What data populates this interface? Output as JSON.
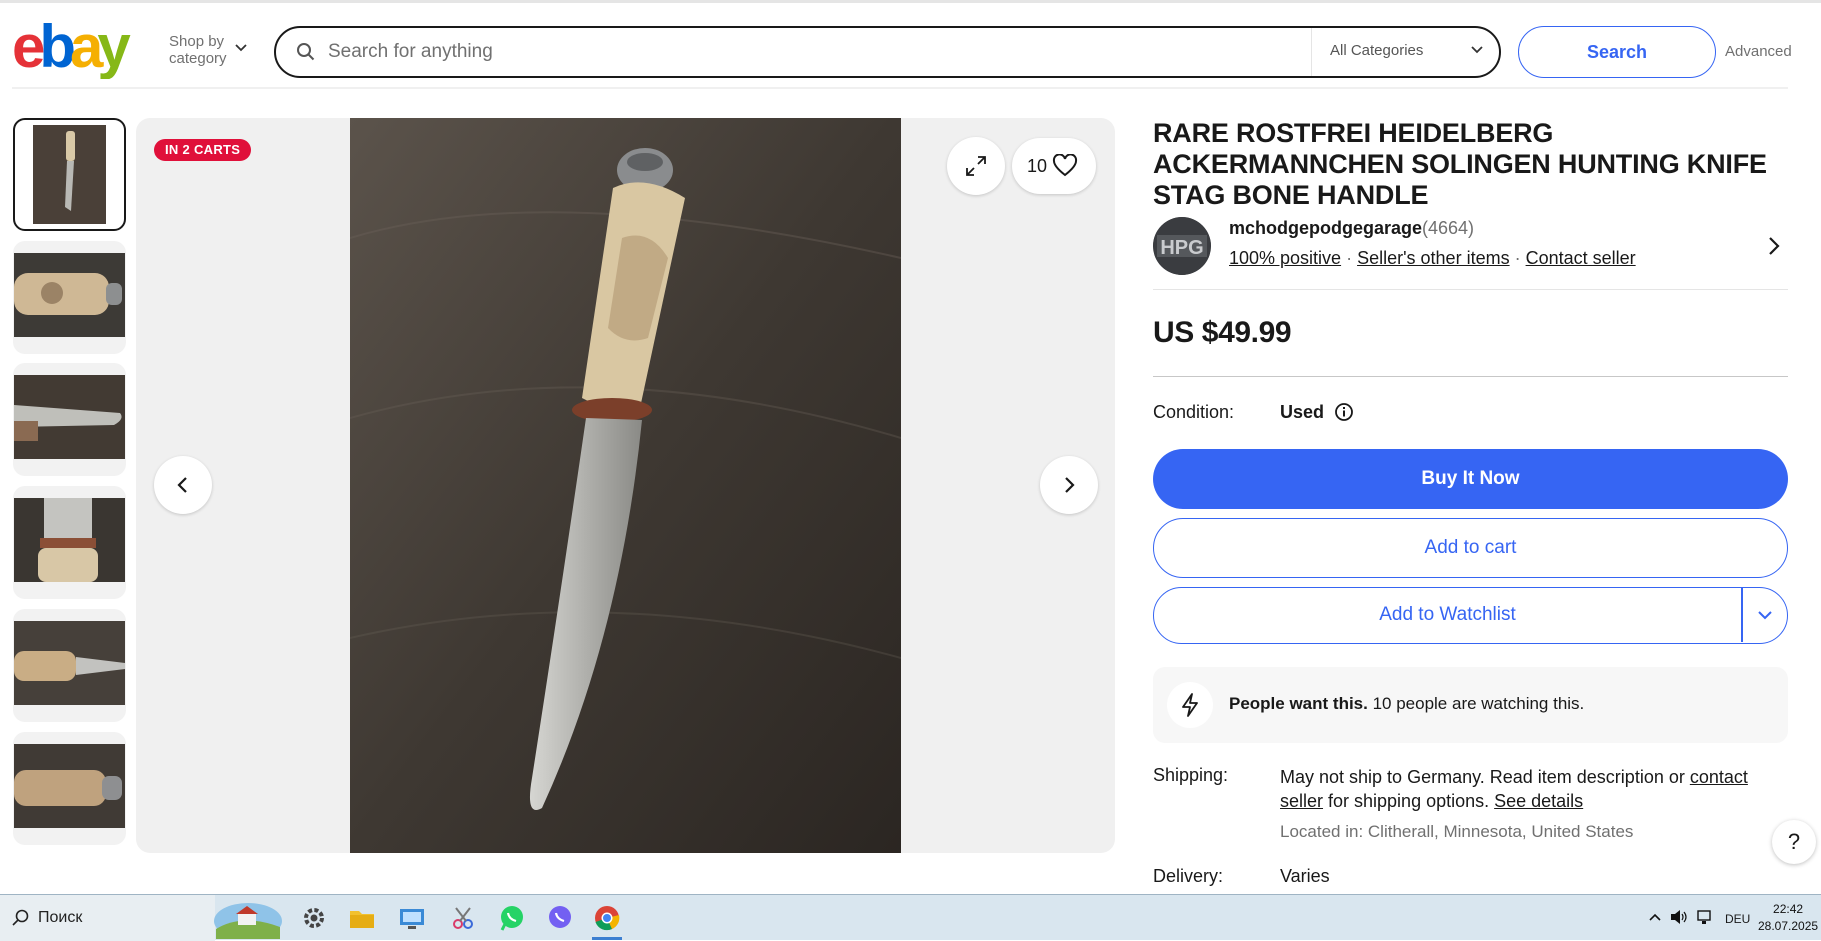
{
  "header": {
    "logo_text": "ebay",
    "shop_by_line1": "Shop by",
    "shop_by_line2": "category",
    "search_placeholder": "Search for anything",
    "category_select": "All Categories",
    "search_button": "Search",
    "advanced_link": "Advanced",
    "colors": {
      "logo_e": "#e53238",
      "logo_b": "#0064d2",
      "logo_a": "#f5af02",
      "logo_y": "#86b817",
      "accent": "#3665f3"
    }
  },
  "gallery": {
    "badge": "IN 2 CARTS",
    "watch_count": "10",
    "thumbnails_count": 6,
    "icons": [
      "expand-icon",
      "heart-icon",
      "chevron-left-icon",
      "chevron-right-icon"
    ]
  },
  "listing": {
    "title": "RARE ROSTFREI HEIDELBERG ACKERMANNCHEN SOLINGEN HUNTING KNIFE STAG BONE HANDLE",
    "seller": {
      "avatar_text": "HPG",
      "name": "mchodgepodgegarage",
      "feedback_count": "(4664)",
      "positive": "100% positive",
      "other_items": "Seller's other items",
      "contact": "Contact seller",
      "dot": "·"
    },
    "price": "US $49.99",
    "condition_label": "Condition:",
    "condition_value": "Used",
    "buy_now": "Buy It Now",
    "add_to_cart": "Add to cart",
    "add_to_watchlist": "Add to Watchlist",
    "people_bold": "People want this.",
    "people_rest": " 10 people are watching this.",
    "shipping_label": "Shipping:",
    "shipping_text_1": "May not ship to Germany. Read item description or ",
    "shipping_link_contact": "contact seller",
    "shipping_text_2": " for shipping options. ",
    "shipping_link_details": "See details",
    "located": "Located in: Clitherall, Minnesota, United States",
    "delivery_label": "Delivery:",
    "delivery_value": "Varies",
    "help": "?"
  },
  "taskbar": {
    "search_text": "Поиск",
    "lang": "DEU",
    "time": "22:42",
    "date": "28.07.2025"
  }
}
